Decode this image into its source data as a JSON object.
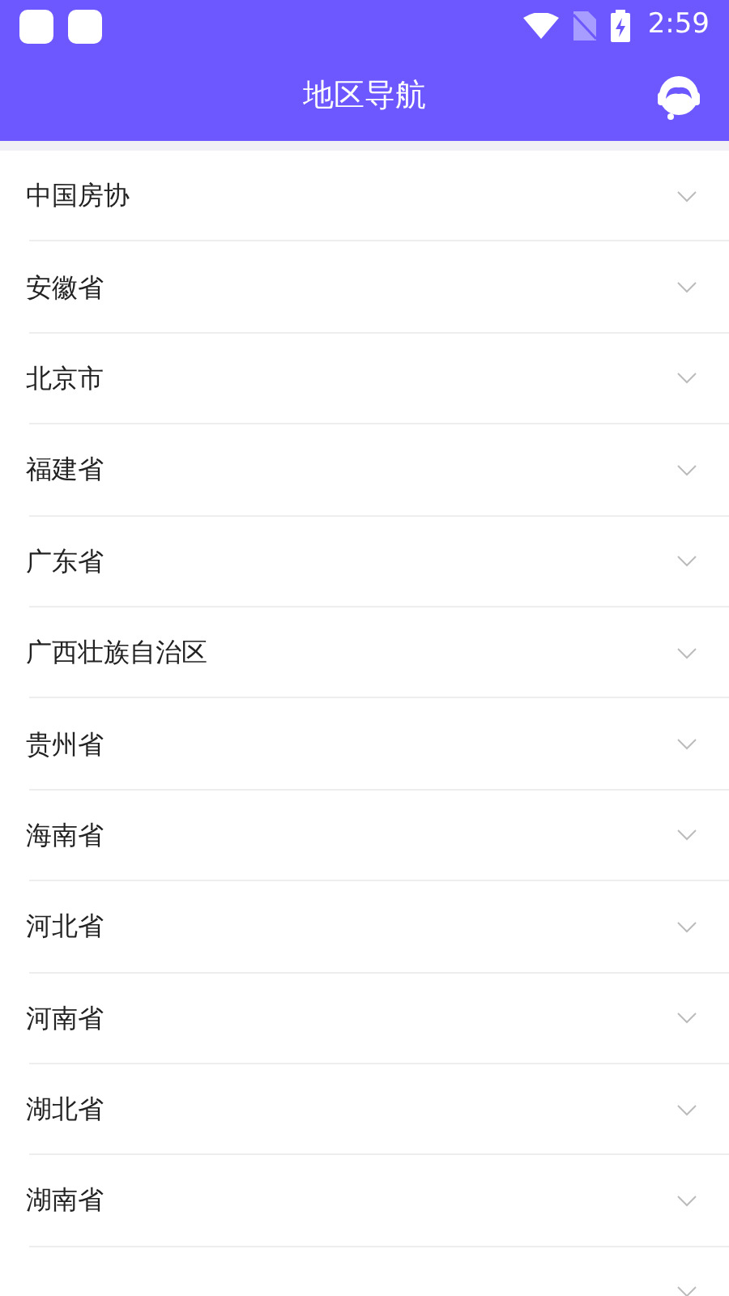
{
  "status_bar": {
    "time": "2:59"
  },
  "header": {
    "title": "地区导航"
  },
  "regions": [
    {
      "name": "中国房协",
      "expanded": false
    },
    {
      "name": "安徽省",
      "expanded": false
    },
    {
      "name": "北京市",
      "expanded": false
    },
    {
      "name": "福建省",
      "expanded": false
    },
    {
      "name": "广东省",
      "expanded": false
    },
    {
      "name": "广西壮族自治区",
      "expanded": false
    },
    {
      "name": "贵州省",
      "expanded": false
    },
    {
      "name": "海南省",
      "expanded": false
    },
    {
      "name": "河北省",
      "expanded": false
    },
    {
      "name": "河南省",
      "expanded": false
    },
    {
      "name": "湖北省",
      "expanded": false
    },
    {
      "name": "湖南省",
      "expanded": false
    },
    {
      "expanded": false
    }
  ]
}
